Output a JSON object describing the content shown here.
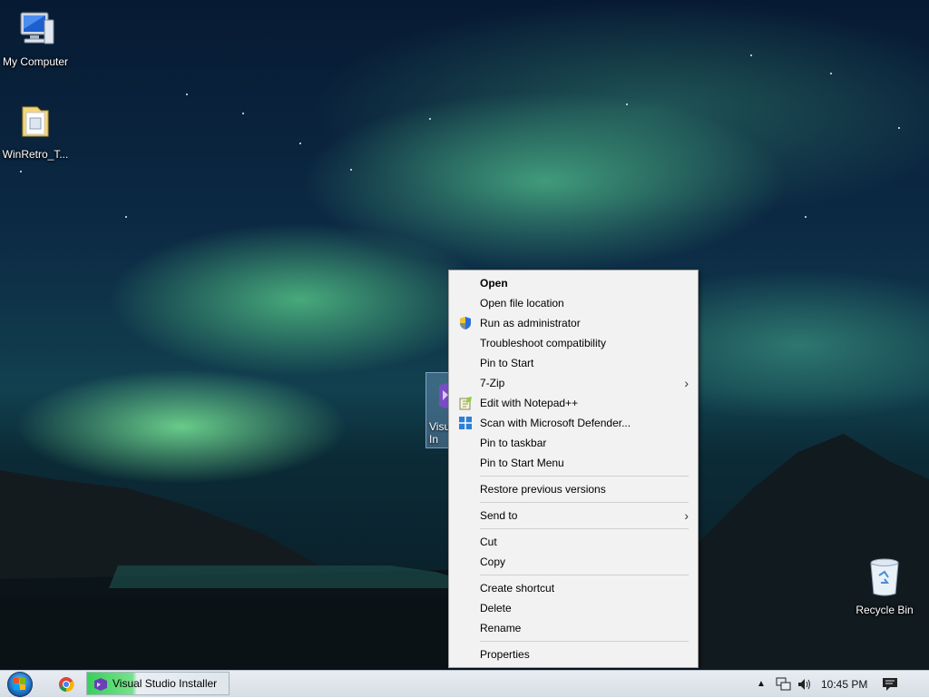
{
  "desktop": {
    "icons": [
      {
        "label": "My Computer"
      },
      {
        "label": "WinRetro_T..."
      },
      {
        "label": "Visual Studio Installer",
        "visible_label": "Visu In"
      },
      {
        "label": "Recycle Bin"
      }
    ]
  },
  "context_menu": {
    "items": [
      {
        "label": "Open",
        "bold": true
      },
      {
        "label": "Open file location"
      },
      {
        "label": "Run as administrator",
        "icon": "shield-icon"
      },
      {
        "label": "Troubleshoot compatibility"
      },
      {
        "label": "Pin to Start"
      },
      {
        "label": "7-Zip",
        "submenu": true
      },
      {
        "label": "Edit with Notepad++",
        "icon": "notepad-plus-plus-icon"
      },
      {
        "label": "Scan with Microsoft Defender...",
        "icon": "defender-icon"
      },
      {
        "label": "Pin to taskbar"
      },
      {
        "label": "Pin to Start Menu"
      },
      {
        "label": "Restore previous versions"
      },
      {
        "label": "Send to",
        "submenu": true
      },
      {
        "label": "Cut"
      },
      {
        "label": "Copy"
      },
      {
        "label": "Create shortcut"
      },
      {
        "label": "Delete"
      },
      {
        "label": "Rename"
      },
      {
        "label": "Properties"
      }
    ],
    "submenu_arrow": "›"
  },
  "taskbar": {
    "task_label": "Visual Studio Installer",
    "clock": "10:45 PM",
    "tray_expand_arrow": "▲"
  },
  "colors": {
    "menu_bg": "#f2f2f2",
    "task_highlight": "#36d15a"
  }
}
